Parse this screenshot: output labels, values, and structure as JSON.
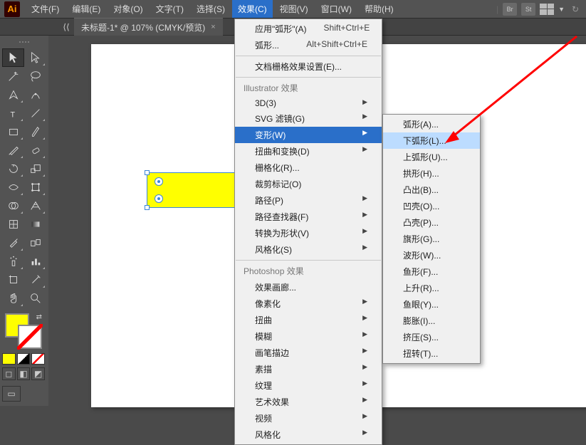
{
  "menubar": {
    "items": [
      "文件(F)",
      "编辑(E)",
      "对象(O)",
      "文字(T)",
      "选择(S)",
      "效果(C)",
      "视图(V)",
      "窗口(W)",
      "帮助(H)"
    ],
    "active_index": 5,
    "right_icons": [
      "Br",
      "St"
    ]
  },
  "tab": {
    "title": "未标题-1* @ 107% (CMYK/预览)",
    "close": "×"
  },
  "effects_menu": {
    "recent_apply": {
      "label": "应用\"弧形\"(A)",
      "shortcut": "Shift+Ctrl+E"
    },
    "recent_last": {
      "label": "弧形...",
      "shortcut": "Alt+Shift+Ctrl+E"
    },
    "doc_raster": "文档栅格效果设置(E)...",
    "header1": "Illustrator 效果",
    "items1": [
      {
        "label": "3D(3)",
        "arrow": true
      },
      {
        "label": "SVG 滤镜(G)",
        "arrow": true
      },
      {
        "label": "变形(W)",
        "arrow": true,
        "highlight": true
      },
      {
        "label": "扭曲和变换(D)",
        "arrow": true
      },
      {
        "label": "栅格化(R)..."
      },
      {
        "label": "裁剪标记(O)"
      },
      {
        "label": "路径(P)",
        "arrow": true
      },
      {
        "label": "路径查找器(F)",
        "arrow": true
      },
      {
        "label": "转换为形状(V)",
        "arrow": true
      },
      {
        "label": "风格化(S)",
        "arrow": true
      }
    ],
    "header2": "Photoshop 效果",
    "items2": [
      {
        "label": "效果画廊..."
      },
      {
        "label": "像素化",
        "arrow": true
      },
      {
        "label": "扭曲",
        "arrow": true
      },
      {
        "label": "模糊",
        "arrow": true
      },
      {
        "label": "画笔描边",
        "arrow": true
      },
      {
        "label": "素描",
        "arrow": true
      },
      {
        "label": "纹理",
        "arrow": true
      },
      {
        "label": "艺术效果",
        "arrow": true
      },
      {
        "label": "视频",
        "arrow": true
      },
      {
        "label": "风格化",
        "arrow": true
      }
    ]
  },
  "warp_submenu": {
    "items": [
      {
        "label": "弧形(A)..."
      },
      {
        "label": "下弧形(L)...",
        "highlight": true
      },
      {
        "label": "上弧形(U)..."
      },
      {
        "label": "拱形(H)..."
      },
      {
        "label": "凸出(B)..."
      },
      {
        "label": "凹壳(O)..."
      },
      {
        "label": "凸壳(P)..."
      },
      {
        "label": "旗形(G)..."
      },
      {
        "label": "波形(W)..."
      },
      {
        "label": "鱼形(F)..."
      },
      {
        "label": "上升(R)..."
      },
      {
        "label": "鱼眼(Y)..."
      },
      {
        "label": "膨胀(I)..."
      },
      {
        "label": "挤压(S)..."
      },
      {
        "label": "扭转(T)..."
      }
    ]
  },
  "logo": "Ai"
}
